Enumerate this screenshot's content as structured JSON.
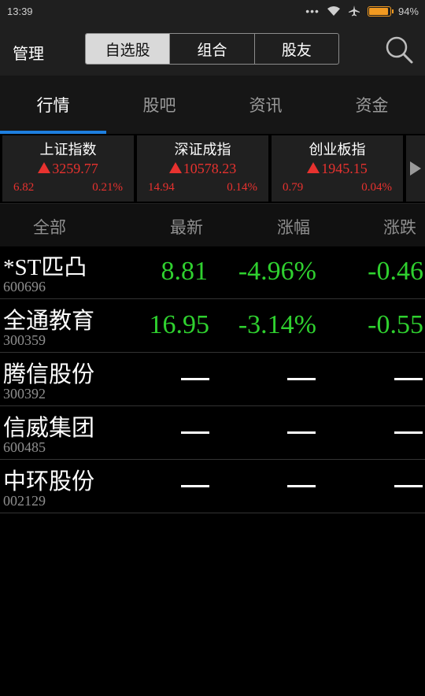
{
  "status_bar": {
    "time": "13:39",
    "battery": "94%",
    "battery_level": 0.94
  },
  "topbar": {
    "manage_label": "管理",
    "segments": [
      "自选股",
      "组合",
      "股友"
    ],
    "active_segment": 0
  },
  "tabs": {
    "items": [
      "行情",
      "股吧",
      "资讯",
      "资金"
    ],
    "active": 0
  },
  "indices": [
    {
      "name": "上证指数",
      "value": "3259.77",
      "change": "6.82",
      "percent": "0.21%"
    },
    {
      "name": "深证成指",
      "value": "10578.23",
      "change": "14.94",
      "percent": "0.14%"
    },
    {
      "name": "创业板指",
      "value": "1945.15",
      "change": "0.79",
      "percent": "0.04%"
    }
  ],
  "list_header": {
    "all": "全部",
    "latest": "最新",
    "change_pct": "涨幅",
    "change": "涨跌"
  },
  "stocks": [
    {
      "name": "*ST匹凸",
      "code": "600696",
      "price": "8.81",
      "pct": "-4.96%",
      "chg": "-0.46"
    },
    {
      "name": "全通教育",
      "code": "300359",
      "price": "16.95",
      "pct": "-3.14%",
      "chg": "-0.55"
    },
    {
      "name": "腾信股份",
      "code": "300392",
      "price": "",
      "pct": "",
      "chg": ""
    },
    {
      "name": "信威集团",
      "code": "600485",
      "price": "",
      "pct": "",
      "chg": ""
    },
    {
      "name": "中环股份",
      "code": "002129",
      "price": "",
      "pct": "",
      "chg": ""
    }
  ],
  "colors": {
    "up": "#e8322f",
    "down": "#2fd12f",
    "accent": "#1e7fe0"
  }
}
